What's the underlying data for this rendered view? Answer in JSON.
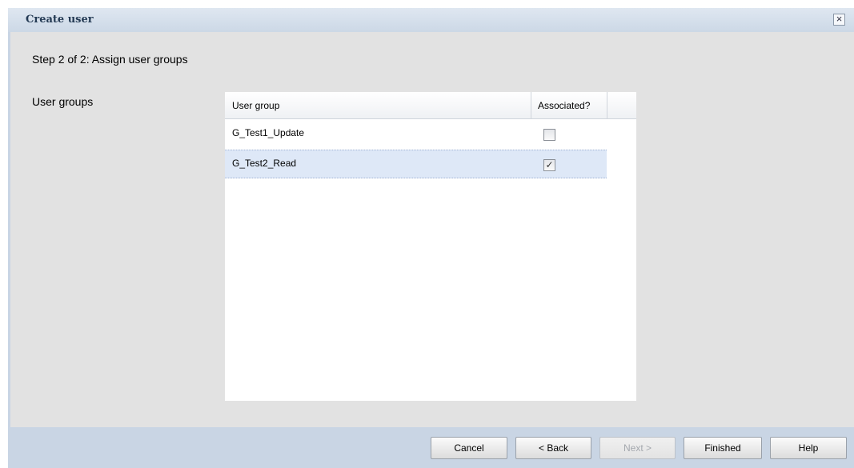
{
  "dialog": {
    "title": "Create user",
    "close_icon": "close-icon",
    "close_glyph": "×"
  },
  "content": {
    "step_text": "Step 2 of 2: Assign user groups",
    "field_label": "User groups"
  },
  "grid": {
    "columns": [
      "User group",
      "Associated?"
    ],
    "rows": [
      {
        "name": "G_Test1_Update",
        "associated": false,
        "check_glyph": ""
      },
      {
        "name": "G_Test2_Read",
        "associated": true,
        "check_glyph": "✓"
      }
    ]
  },
  "buttons": {
    "cancel": "Cancel",
    "back": "< Back",
    "next": "Next >",
    "finished": "Finished",
    "help": "Help"
  },
  "colors": {
    "title_bar": "#ccd8e6",
    "body_bg": "#e2e2e2",
    "selected_row": "#dee8f7"
  }
}
